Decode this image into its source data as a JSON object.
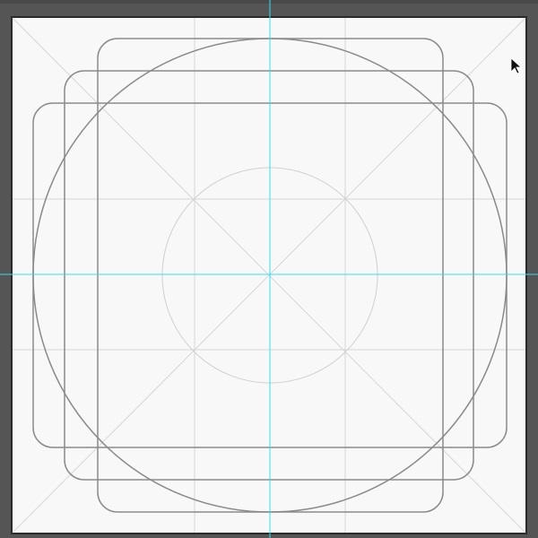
{
  "canvas": {
    "background_color": "#555555",
    "artboard_color": "#f8f8f8",
    "artboard_border_color": "#2a2a2a",
    "guide_color": "#33e0f0",
    "grid_color": "#d4d4d4",
    "keyline_color": "#8a8a8a"
  },
  "template": {
    "shapes": [
      "artboard",
      "diagonal-guides",
      "center-guides",
      "grid-lines",
      "inner-circle",
      "outer-circle",
      "square-keyline",
      "portrait-rect-keyline",
      "landscape-rect-keyline"
    ]
  },
  "cursor": {
    "icon": "arrow-pointer-icon"
  }
}
